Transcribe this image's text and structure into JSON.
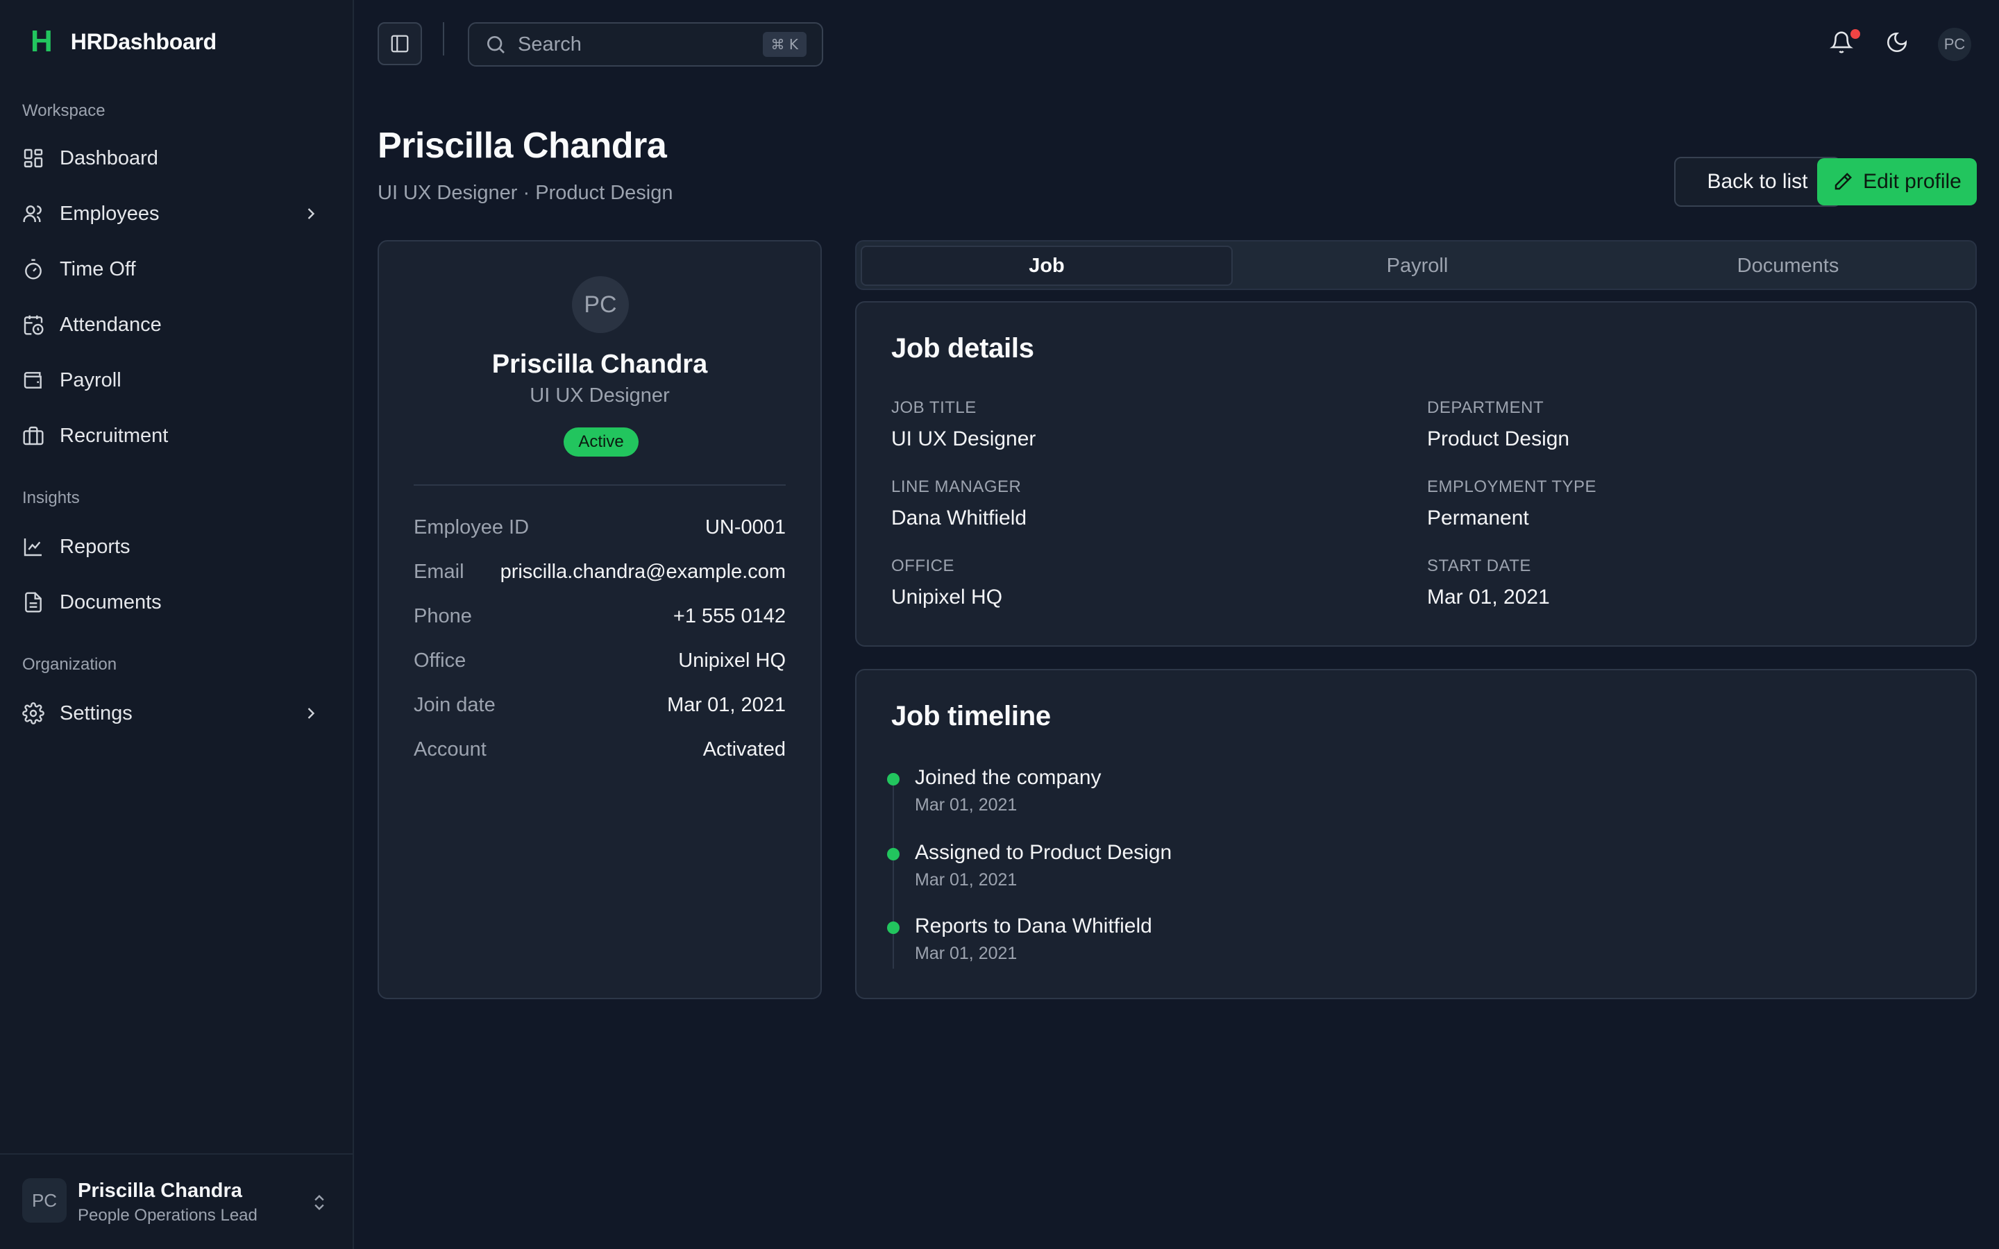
{
  "brand": {
    "logo": "H",
    "name": "HRDashboard"
  },
  "sidebar": {
    "sections": [
      {
        "label": "Workspace"
      },
      {
        "label": "Insights"
      },
      {
        "label": "Organization"
      }
    ],
    "items": [
      {
        "label": "Dashboard",
        "icon": "dashboard-icon"
      },
      {
        "label": "Employees",
        "icon": "users-icon",
        "expandable": true
      },
      {
        "label": "Time Off",
        "icon": "timer-icon"
      },
      {
        "label": "Attendance",
        "icon": "calendar-clock-icon"
      },
      {
        "label": "Payroll",
        "icon": "wallet-icon"
      },
      {
        "label": "Recruitment",
        "icon": "briefcase-icon"
      },
      {
        "label": "Reports",
        "icon": "chart-line-icon"
      },
      {
        "label": "Documents",
        "icon": "file-icon"
      },
      {
        "label": "Settings",
        "icon": "gear-icon",
        "expandable": true
      }
    ],
    "user": {
      "initials": "PC",
      "name": "Priscilla Chandra",
      "role": "People Operations Lead"
    }
  },
  "topbar": {
    "search_placeholder": "Search",
    "shortcut": "⌘ K",
    "avatar_initials": "PC"
  },
  "header": {
    "title": "Priscilla Chandra",
    "subtitle": "UI UX Designer · Product Design",
    "back_label": "Back to list",
    "edit_label": "Edit profile"
  },
  "profile": {
    "initials": "PC",
    "name": "Priscilla Chandra",
    "role": "UI UX Designer",
    "status": "Active",
    "rows": [
      {
        "key": "Employee ID",
        "value": "UN-0001"
      },
      {
        "key": "Email",
        "value": "priscilla.chandra@example.com"
      },
      {
        "key": "Phone",
        "value": "+1 555 0142"
      },
      {
        "key": "Office",
        "value": "Unipixel HQ"
      },
      {
        "key": "Join date",
        "value": "Mar 01, 2021"
      },
      {
        "key": "Account",
        "value": "Activated"
      }
    ]
  },
  "tabs": [
    {
      "label": "Job",
      "active": true
    },
    {
      "label": "Payroll",
      "active": false
    },
    {
      "label": "Documents",
      "active": false
    }
  ],
  "job_details": {
    "title": "Job details",
    "fields": [
      {
        "label": "JOB TITLE",
        "value": "UI UX Designer"
      },
      {
        "label": "DEPARTMENT",
        "value": "Product Design"
      },
      {
        "label": "LINE MANAGER",
        "value": "Dana Whitfield"
      },
      {
        "label": "EMPLOYMENT TYPE",
        "value": "Permanent"
      },
      {
        "label": "OFFICE",
        "value": "Unipixel HQ"
      },
      {
        "label": "START DATE",
        "value": "Mar 01, 2021"
      }
    ]
  },
  "timeline": {
    "title": "Job timeline",
    "events": [
      {
        "title": "Joined the company",
        "date": "Mar 01, 2021"
      },
      {
        "title": "Assigned to Product Design",
        "date": "Mar 01, 2021"
      },
      {
        "title": "Reports to Dana Whitfield",
        "date": "Mar 01, 2021"
      }
    ]
  },
  "colors": {
    "accent": "#22c55e",
    "background": "#111827",
    "card": "#1a2230",
    "notification": "#ef4444"
  }
}
